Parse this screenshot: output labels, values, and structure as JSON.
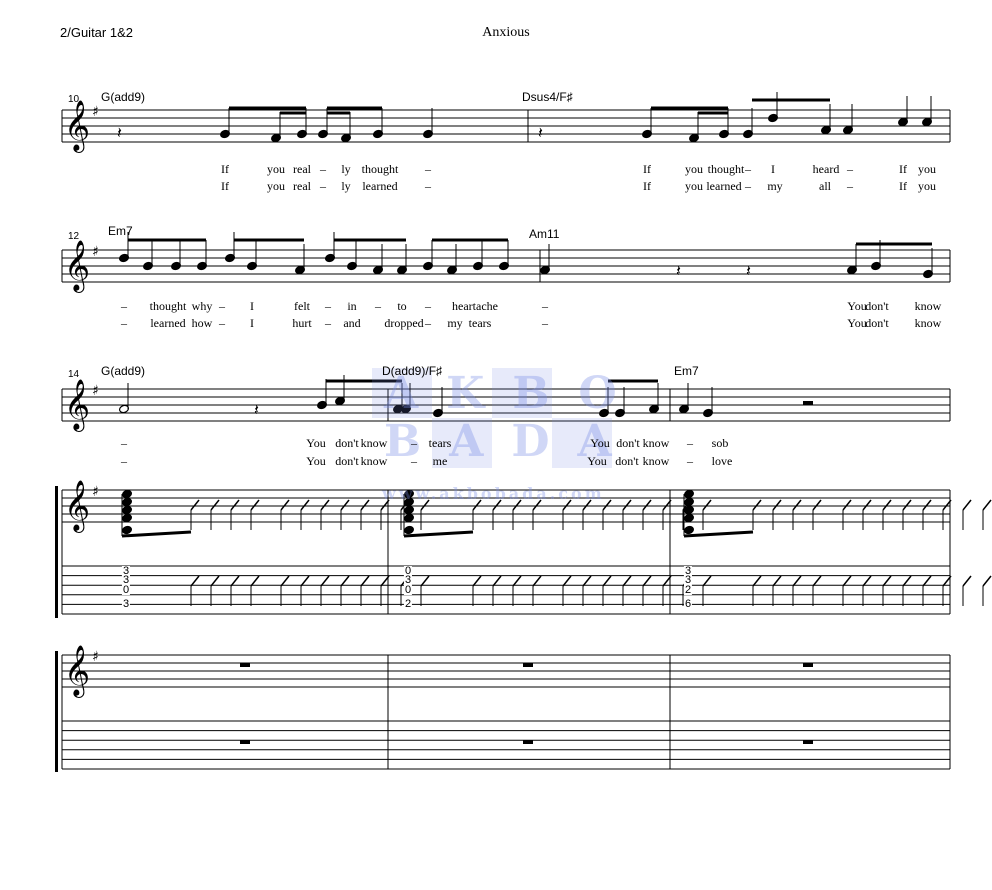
{
  "header": {
    "part": "2/Guitar 1&2",
    "title": "Anxious"
  },
  "watermark": {
    "logo": "AKBOBADA",
    "url": "www.akbobada.com"
  },
  "systems": [
    {
      "measure_number": "10",
      "chords": [
        "G(add9)",
        "Dsus4/F♯"
      ],
      "lyrics": [
        [
          "If",
          "you",
          "real",
          "–",
          "ly",
          "thought",
          "–",
          "If",
          "you",
          "thought",
          "–",
          "I",
          "heard",
          "–",
          "If",
          "you"
        ],
        [
          "If",
          "you",
          "real",
          "–",
          "ly",
          "learned",
          "–",
          "If",
          "you",
          "learned",
          "–",
          "my",
          "all",
          "–",
          "If",
          "you"
        ]
      ]
    },
    {
      "measure_number": "12",
      "chords": [
        "Em7",
        "Am11"
      ],
      "lyrics": [
        [
          "–",
          "thought",
          "why",
          "–",
          "I",
          "felt",
          "–",
          "in",
          "–",
          "to",
          "–",
          "heartache",
          "–",
          "You",
          "don't",
          "know"
        ],
        [
          "–",
          "learned",
          "how",
          "–",
          "I",
          "hurt",
          "–",
          "and",
          "dropped",
          "–",
          "my",
          "tears",
          "–",
          "You",
          "don't",
          "know"
        ]
      ]
    },
    {
      "measure_number": "14",
      "chords": [
        "G(add9)",
        "D(add9)/F♯",
        "Em7"
      ],
      "lyrics": [
        [
          "–",
          "You",
          "don't",
          "know",
          "–",
          "tears",
          "You",
          "don't",
          "know",
          "–",
          "sob"
        ],
        [
          "–",
          "You",
          "don't",
          "know",
          "–",
          "me",
          "You",
          "don't",
          "know",
          "–",
          "love"
        ]
      ]
    }
  ],
  "guitar_tab": [
    [
      "3",
      "3",
      "0",
      "3"
    ],
    [
      "0",
      "3",
      "0",
      "2"
    ],
    [
      "3",
      "3",
      "2",
      "6"
    ]
  ]
}
